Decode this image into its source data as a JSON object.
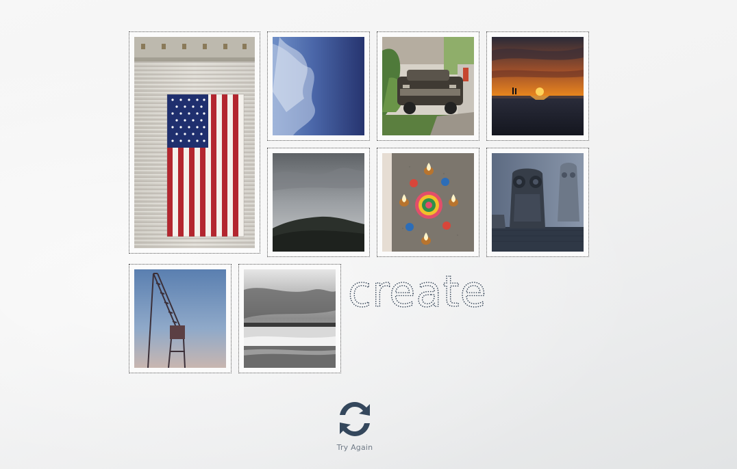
{
  "heading": {
    "text": "create"
  },
  "gallery": {
    "photos": [
      {
        "id": "photo-flag",
        "subject": "american-flag-on-corrugated-wall"
      },
      {
        "id": "photo-sky",
        "subject": "blue-sky-clouds"
      },
      {
        "id": "photo-car",
        "subject": "old-car-in-vegetation"
      },
      {
        "id": "photo-sunset",
        "subject": "sunset-over-sea"
      },
      {
        "id": "photo-hill",
        "subject": "overcast-forested-hill"
      },
      {
        "id": "photo-rangoli",
        "subject": "rangoli-with-diyas"
      },
      {
        "id": "photo-owl",
        "subject": "owl-figurines"
      },
      {
        "id": "photo-crane",
        "subject": "harbor-crane-at-dusk"
      },
      {
        "id": "photo-beach",
        "subject": "black-and-white-beach"
      }
    ]
  },
  "actions": {
    "try_again_label": "Try Again",
    "try_again_icon": "refresh-icon"
  },
  "colors": {
    "icon": "#34475c",
    "label": "#6f7a86",
    "tile_border": "#555555"
  }
}
